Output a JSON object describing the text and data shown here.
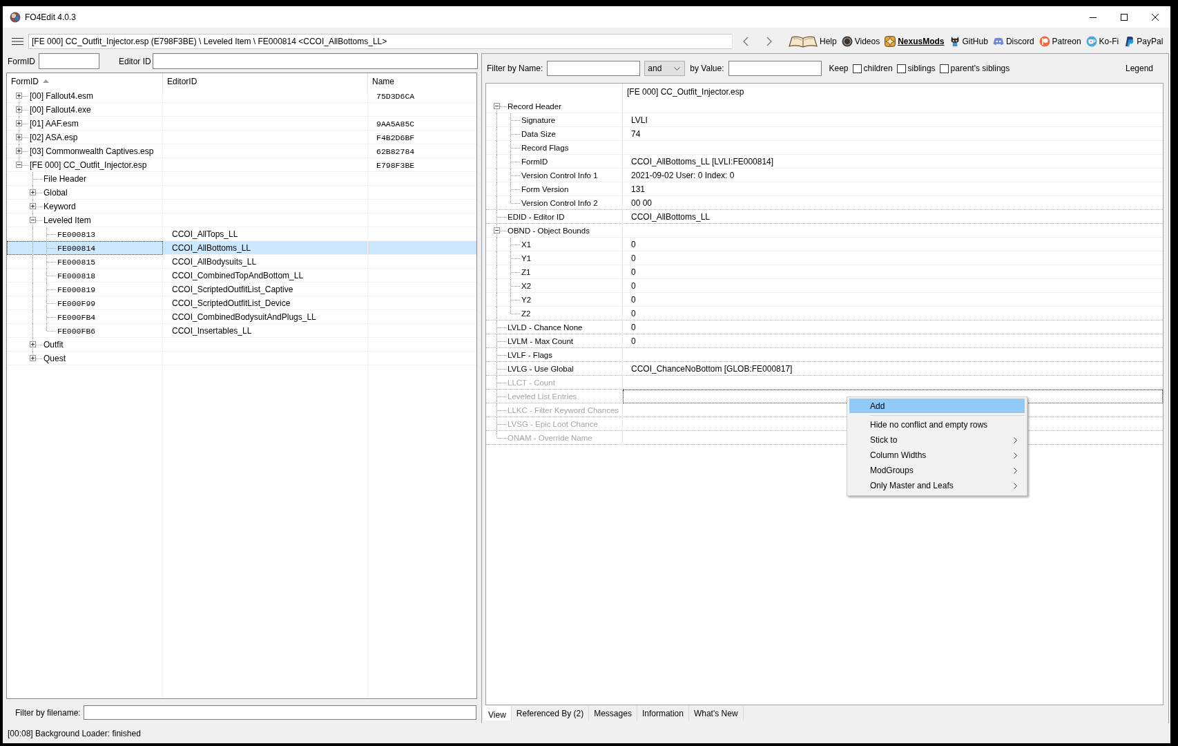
{
  "window": {
    "title": "FO4Edit 4.0.3"
  },
  "toolbar": {
    "path": "[FE 000] CC_Outfit_Injector.esp (E798F3BE) \\ Leveled Item \\ FE000814 <CCOI_AllBottoms_LL>",
    "links": [
      {
        "label": "Help",
        "emphasized": false
      },
      {
        "label": "Videos",
        "emphasized": false
      },
      {
        "label": "NexusMods",
        "emphasized": true
      },
      {
        "label": "GitHub",
        "emphasized": false
      },
      {
        "label": "Discord",
        "emphasized": false
      },
      {
        "label": "Patreon",
        "emphasized": false
      },
      {
        "label": "Ko-Fi",
        "emphasized": false
      },
      {
        "label": "PayPal",
        "emphasized": false
      }
    ]
  },
  "navigator": {
    "filters": [
      {
        "label": "FormID"
      },
      {
        "label": "Editor ID"
      }
    ],
    "tree": {
      "columns": [
        {
          "label": "FormID",
          "sorted": true
        },
        {
          "label": "EditorID",
          "sorted": false
        },
        {
          "label": "Name",
          "sorted": false
        }
      ],
      "nodes": [
        {
          "kind": "folder",
          "label": "[00] Fallout4.esm",
          "name": "75D3D6CA",
          "expanded": false
        },
        {
          "kind": "folder",
          "label": "[00] Fallout4.exe",
          "expanded": false
        },
        {
          "kind": "folder",
          "label": "[01] AAF.esm",
          "name": "9AA5A85C",
          "expanded": false
        },
        {
          "kind": "folder",
          "label": "[02] ASA.esp",
          "name": "F4B2D6BF",
          "expanded": false
        },
        {
          "kind": "folder",
          "label": "[03] Commonwealth Captives.esp",
          "name": "62B82784",
          "expanded": false
        },
        {
          "kind": "folder",
          "label": "[FE 000] CC_Outfit_Injector.esp",
          "name": "E798F3BE",
          "expanded": true,
          "children": [
            {
              "kind": "leaf",
              "label": "File Header"
            },
            {
              "kind": "folder",
              "label": "Global",
              "expanded": false
            },
            {
              "kind": "folder",
              "label": "Keyword",
              "expanded": false
            },
            {
              "kind": "folder",
              "label": "Leveled Item",
              "expanded": true,
              "children": [
                {
                  "kind": "record",
                  "form_id": "FE000813",
                  "editor_id": "CCOI_AllTops_LL",
                  "selected": false
                },
                {
                  "kind": "record",
                  "form_id": "FE000814",
                  "editor_id": "CCOI_AllBottoms_LL",
                  "selected": true
                },
                {
                  "kind": "record",
                  "form_id": "FE000815",
                  "editor_id": "CCOI_AllBodysuits_LL",
                  "selected": false
                },
                {
                  "kind": "record",
                  "form_id": "FE000818",
                  "editor_id": "CCOI_CombinedTopAndBottom_LL",
                  "selected": false
                },
                {
                  "kind": "record",
                  "form_id": "FE000819",
                  "editor_id": "CCOI_ScriptedOutfitList_Captive",
                  "selected": false
                },
                {
                  "kind": "record",
                  "form_id": "FE000F99",
                  "editor_id": "CCOI_ScriptedOutfitList_Device",
                  "selected": false
                },
                {
                  "kind": "record",
                  "form_id": "FE000FB4",
                  "editor_id": "CCOI_CombinedBodysuitAndPlugs_LL",
                  "selected": false
                },
                {
                  "kind": "record",
                  "form_id": "FE000FB6",
                  "editor_id": "CCOI_Insertables_LL",
                  "selected": false
                }
              ]
            },
            {
              "kind": "folder",
              "label": "Outfit",
              "expanded": false
            },
            {
              "kind": "folder",
              "label": "Quest",
              "expanded": false
            }
          ]
        }
      ]
    },
    "file_filter": {
      "label": "Filter by filename:"
    }
  },
  "record_view": {
    "filter": {
      "name_label": "Filter by Name:",
      "operator": "and",
      "value_label": "by Value:",
      "keep_label": "Keep",
      "keep_options": [
        {
          "label": "children",
          "checked": false
        },
        {
          "label": "siblings",
          "checked": false
        },
        {
          "label": "parent's siblings",
          "checked": false
        }
      ],
      "legend": "Legend"
    },
    "header": "[FE 000] CC_Outfit_Injector.esp",
    "rows": [
      {
        "label": "Record Header",
        "expanded": true,
        "disabled": false,
        "selected": false,
        "children": [
          {
            "label": "Signature",
            "value": "LVLI",
            "disabled": false,
            "selected": false
          },
          {
            "label": "Data Size",
            "value": "74",
            "disabled": false,
            "selected": false
          },
          {
            "label": "Record Flags",
            "disabled": false,
            "selected": false
          },
          {
            "label": "FormID",
            "value": "CCOI_AllBottoms_LL [LVLI:FE000814]",
            "disabled": false,
            "selected": false
          },
          {
            "label": "Version Control Info 1",
            "value": "2021-09-02 User: 0 Index: 0",
            "disabled": false,
            "selected": false
          },
          {
            "label": "Form Version",
            "value": "131",
            "disabled": false,
            "selected": false
          },
          {
            "label": "Version Control Info 2",
            "value": "00 00",
            "disabled": false,
            "selected": false
          }
        ]
      },
      {
        "label": "EDID - Editor ID",
        "value": "CCOI_AllBottoms_LL",
        "disabled": false,
        "selected": false
      },
      {
        "label": "OBND - Object Bounds",
        "expanded": true,
        "disabled": false,
        "selected": false,
        "children": [
          {
            "label": "X1",
            "value": "0",
            "disabled": false,
            "selected": false
          },
          {
            "label": "Y1",
            "value": "0",
            "disabled": false,
            "selected": false
          },
          {
            "label": "Z1",
            "value": "0",
            "disabled": false,
            "selected": false
          },
          {
            "label": "X2",
            "value": "0",
            "disabled": false,
            "selected": false
          },
          {
            "label": "Y2",
            "value": "0",
            "disabled": false,
            "selected": false
          },
          {
            "label": "Z2",
            "value": "0",
            "disabled": false,
            "selected": false
          }
        ]
      },
      {
        "label": "LVLD - Chance None",
        "value": "0",
        "disabled": false,
        "selected": false
      },
      {
        "label": "LVLM - Max Count",
        "value": "0",
        "disabled": false,
        "selected": false
      },
      {
        "label": "LVLF - Flags",
        "disabled": false,
        "selected": false
      },
      {
        "label": "LVLG - Use Global",
        "value": "CCOI_ChanceNoBottom [GLOB:FE000817]",
        "disabled": false,
        "selected": false
      },
      {
        "label": "LLCT - Count",
        "disabled": true,
        "selected": false
      },
      {
        "label": "Leveled List Entries",
        "disabled": true,
        "selected": true
      },
      {
        "label": "LLKC - Filter Keyword Chances",
        "disabled": true,
        "selected": false
      },
      {
        "label": "LVSG - Epic Loot Chance",
        "disabled": true,
        "selected": false
      },
      {
        "label": "ONAM - Override Name",
        "disabled": true,
        "selected": false
      }
    ],
    "tabs": [
      {
        "label": "View",
        "selected": true
      },
      {
        "label": "Referenced By (2)",
        "selected": false
      },
      {
        "label": "Messages",
        "selected": false
      },
      {
        "label": "Information",
        "selected": false
      },
      {
        "label": "What's New",
        "selected": false
      }
    ]
  },
  "context_menu": {
    "items": [
      {
        "kind": "item",
        "label": "Add",
        "selected": true,
        "submenu": false
      },
      {
        "kind": "separator"
      },
      {
        "kind": "item",
        "label": "Hide no conflict and empty rows",
        "selected": false,
        "submenu": false
      },
      {
        "kind": "item",
        "label": "Stick to",
        "selected": false,
        "submenu": true
      },
      {
        "kind": "item",
        "label": "Column Widths",
        "selected": false,
        "submenu": true
      },
      {
        "kind": "item",
        "label": "ModGroups",
        "selected": false,
        "submenu": true
      },
      {
        "kind": "item",
        "label": "Only Master and Leafs",
        "selected": false,
        "submenu": true
      }
    ]
  },
  "status_bar": {
    "text": "[00:08] Background Loader: finished"
  }
}
